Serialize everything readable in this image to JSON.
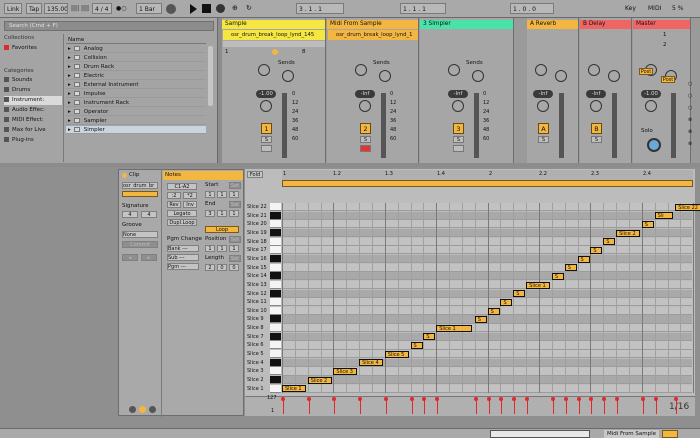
{
  "transport": {
    "link": "Link",
    "tap": "Tap",
    "tempo": "135.00",
    "tempo_icons": "|||| ||||",
    "time_sig": "4 / 4",
    "metro_icon": "●○",
    "quantize": "1 Bar",
    "position": "3 .   1 .   1",
    "loop_start": "1 .   1 .   1",
    "loop_length": "1 .   0 .   0",
    "key": "Key",
    "midi": "MIDI",
    "cpu": "5 %"
  },
  "browser": {
    "search_placeholder": "Search (Cmd + F)",
    "collections_header": "Collections",
    "favorites": "Favorites",
    "categories_header": "Categories",
    "categories": [
      "Sounds",
      "Drums",
      "Instrument:",
      "Audio Effec:",
      "MIDI Effect:",
      "Max for Live",
      "Plug-ins"
    ],
    "name_header": "Name",
    "items": [
      "Analog",
      "Collision",
      "Drum Rack",
      "Electric",
      "External Instrument",
      "Impulse",
      "Instrument Rack",
      "Operator",
      "Sampler",
      "Simpler"
    ]
  },
  "tracks": [
    {
      "name": "Sample",
      "color": "#f5e642",
      "clip": "osr_drum_break_loop_lynd_145",
      "num": "1",
      "vol": "-1.00",
      "s": "S",
      "io_a": "1",
      "io_b": "8"
    },
    {
      "name": "Midi From Sample",
      "color": "#f3b640",
      "clip": "osr_drum_break_loop_lynd_1",
      "num": "2",
      "vol": "-Inf",
      "s": "S"
    },
    {
      "name": "3 Simpler",
      "color": "#49e3a8",
      "clip": "",
      "num": "3",
      "vol": "-Inf",
      "s": "S"
    },
    {
      "name": "A Reverb",
      "color": "#f3b640",
      "num": "A",
      "vol": "-Inf",
      "s": "S"
    },
    {
      "name": "B Delay",
      "color": "#f06464",
      "num": "B",
      "vol": "-Inf",
      "s": "S"
    },
    {
      "name": "Master",
      "color": "#f06464",
      "vol": "-1.00",
      "post": "Post",
      "solo": "Solo",
      "cue": "1",
      "cue2": "2"
    }
  ],
  "sends_label": "Sends",
  "meter_scale": [
    "0",
    "12",
    "24",
    "36",
    "48",
    "60"
  ],
  "clip": {
    "title": "Clip",
    "name": "osr_drum_br",
    "signature_label": "Signature",
    "sig_num": "4",
    "sig_den": "4",
    "groove_label": "Groove",
    "groove_value": "None",
    "commit": "Commit"
  },
  "notes": {
    "title": "Notes",
    "range": "C1-A2",
    "half": ":2",
    "double": "*2",
    "rev": "Rev",
    "inv": "Inv",
    "legato": "Legato",
    "dupl": "Dupl.Loop",
    "start_label": "Start",
    "end_label": "End",
    "loop_label": "Loop",
    "position_label": "Position",
    "length_label": "Length",
    "set": "Set",
    "start_vals": [
      "1",
      "1",
      "1"
    ],
    "end_vals": [
      "3",
      "1",
      "1"
    ],
    "position_vals": [
      "1",
      "1",
      "1"
    ],
    "length_vals": [
      "2",
      "0",
      "0"
    ],
    "pgm_change": "Pgm Change",
    "bank": "Bank ---",
    "sub": "Sub ---",
    "pgm": "Pgm ---"
  },
  "editor": {
    "fold": "Fold",
    "ruler": [
      "1",
      "1.2",
      "1.3",
      "1.4",
      "2",
      "2.2",
      "2.3",
      "2.4"
    ],
    "keys": [
      "Slice 22",
      "Slice 21",
      "Slice 20",
      "Slice 19",
      "Slice 18",
      "Slice 17",
      "Slice 16",
      "Slice 15",
      "Slice 14",
      "Slice 13",
      "Slice 12",
      "Slice 11",
      "Slice 10",
      "Slice 9",
      "Slice 8",
      "Slice 7",
      "Slice 6",
      "Slice 5",
      "Slice 4",
      "Slice 3",
      "Slice 2",
      "Slice 1"
    ],
    "note_labels": [
      "Slice 1",
      "Slice 2",
      "Slice 3",
      "Slice 4",
      "Slice 5",
      "S",
      "S",
      "Slice 1",
      "S",
      "S",
      "S",
      "S",
      "Slice 1",
      "S",
      "S",
      "S",
      "S",
      "S",
      "Slice 2",
      "S",
      "Sli",
      "Slice 22"
    ],
    "vel_top": "127",
    "vel_bottom": "1",
    "grid": "1/16"
  },
  "status": {
    "track": "Midi From Sample"
  }
}
